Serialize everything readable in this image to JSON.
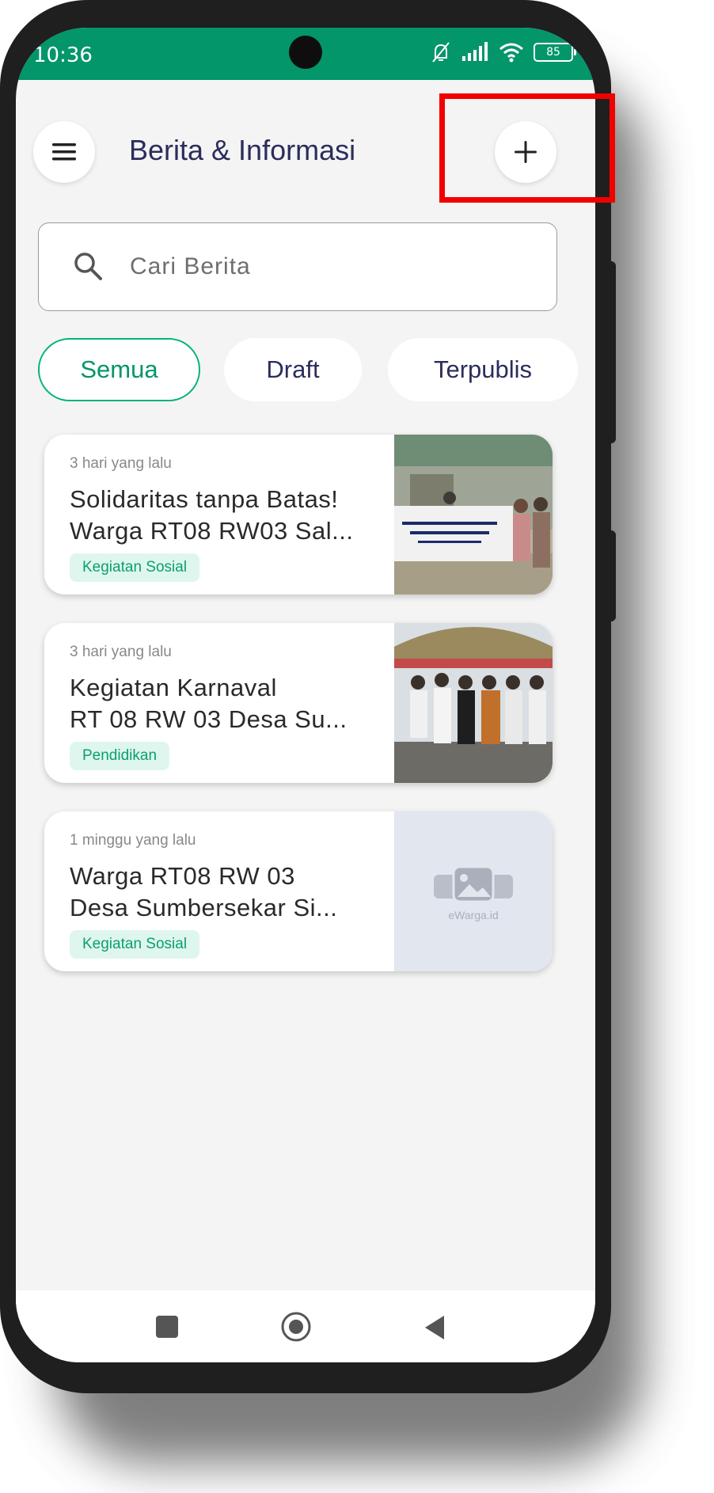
{
  "status_bar": {
    "time": "10:36",
    "battery": "85",
    "icons": [
      "bell-off-icon",
      "signal-icon",
      "wifi-icon",
      "battery-icon"
    ]
  },
  "header": {
    "menu_icon": "hamburger-menu-icon",
    "title": "Berita & Informasi",
    "add_icon": "plus-icon"
  },
  "search": {
    "icon": "search-icon",
    "placeholder": "Cari Berita"
  },
  "filters": [
    {
      "label": "Semua",
      "active": true
    },
    {
      "label": "Draft",
      "active": false
    },
    {
      "label": "Terpublis",
      "active": false
    }
  ],
  "news": [
    {
      "time": "3 hari yang lalu",
      "title_line1": "Solidaritas tanpa Batas!",
      "title_line2": "Warga RT08 RW03 Sal...",
      "tag": "Kegiatan Sosial",
      "image": "photo-banner-event"
    },
    {
      "time": "3 hari yang lalu",
      "title_line1": "Kegiatan Karnaval",
      "title_line2": "RT 08 RW 03 Desa Su...",
      "tag": "Pendidikan",
      "image": "photo-group-carnival"
    },
    {
      "time": "1 minggu yang lalu",
      "title_line1": "Warga RT08 RW 03",
      "title_line2": "Desa Sumbersekar Si...",
      "tag": "Kegiatan Sosial",
      "image": "placeholder-image",
      "placeholder_brand": "eWarga.id"
    }
  ],
  "nav_bar": [
    "recent-apps-icon",
    "home-icon",
    "back-icon"
  ],
  "colors": {
    "primary": "#02966a",
    "title": "#2b2d5c",
    "highlight": "#f20000",
    "background": "#f4f4f4"
  }
}
